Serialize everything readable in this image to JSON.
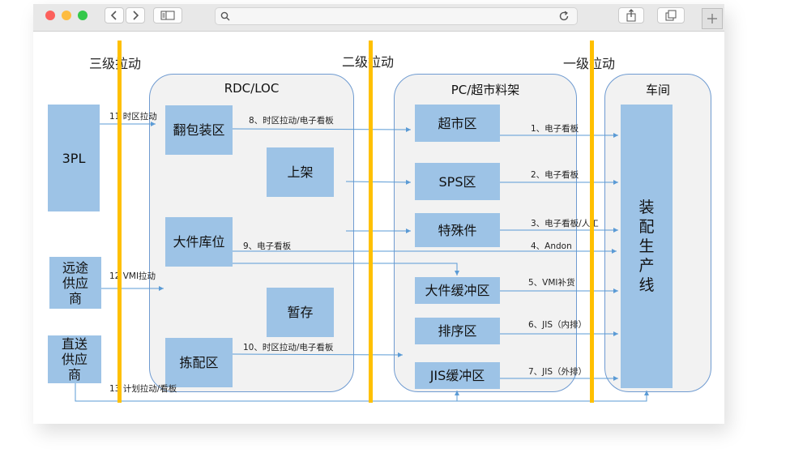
{
  "browser": {
    "window_controls": [
      "close",
      "minimize",
      "zoom"
    ],
    "nav_icons": [
      "chevron-left-icon",
      "chevron-right-icon",
      "sidebar-icon",
      "search-icon",
      "reload-icon",
      "share-icon",
      "tabs-icon",
      "new-tab-icon"
    ]
  },
  "diagram": {
    "tiers": {
      "tier3": "三级拉动",
      "tier2": "二级拉动",
      "tier1": "一级拉动"
    },
    "containers": {
      "rdc": "RDC/LOC",
      "pc": "PC/超市料架",
      "workshop": "车间"
    },
    "sources": {
      "tpl": "3PL",
      "far_supplier": "远途\n供应\n商",
      "direct_supplier": "直送\n供应\n商"
    },
    "rdc_boxes": {
      "repack": "翻包装区",
      "shelve": "上架",
      "large_parts": "大件库位",
      "temp": "暂存",
      "picking": "拣配区"
    },
    "pc_boxes": {
      "supermarket": "超市区",
      "sps": "SPS区",
      "special": "特殊件",
      "large_buffer": "大件缓冲区",
      "sequencing": "排序区",
      "jis_buffer": "JIS缓冲区"
    },
    "assembly": "装\n配\n生\n产\n线",
    "labels": {
      "l11": "11  时区拉动",
      "l12": "12  VMI拉动",
      "l13": "13  计划拉动/看板",
      "l8": "8、时区拉动/电子看板",
      "l9": "9、电子看板",
      "l10": "10、时区拉动/电子看板",
      "l1": "1、电子看板",
      "l2": "2、电子看板",
      "l3": "3、电子看板/人工",
      "l4": "4、Andon",
      "l5": "5、VMI补货",
      "l6": "6、JIS（内排）",
      "l7": "7、JIS（外排）"
    },
    "colors": {
      "box": "#9dc3e6",
      "container": "#f2f2f2",
      "border": "#6f9bd1",
      "tier_bar": "#ffc000",
      "arrow": "#5b9bd5"
    }
  }
}
